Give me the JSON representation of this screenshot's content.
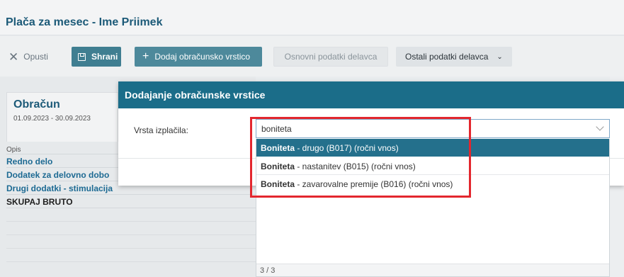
{
  "page": {
    "title": "Plača za mesec - Ime Priimek"
  },
  "toolbar": {
    "opusti": "Opusti",
    "shrani": "Shrani",
    "dodaj": "Dodaj obračunsko vrstico",
    "osnovni": "Osnovni podatki delavca",
    "ostali": "Ostali podatki delavca"
  },
  "obracun": {
    "title": "Obračun",
    "dates": "01.09.2023 - 30.09.2023",
    "column_header": "Opis",
    "rows": [
      "Redno delo",
      "Dodatek za delovno dobo",
      "Drugi dodatki - stimulacija",
      "SKUPAJ BRUTO"
    ]
  },
  "modal": {
    "title": "Dodajanje obračunske vrstice",
    "field_label": "Vrsta izplačila:",
    "select_value": "boniteta"
  },
  "dropdown": {
    "options": [
      {
        "bold": "Boniteta",
        "rest": " - drugo (B017) (ročni vnos)"
      },
      {
        "bold": "Boniteta",
        "rest": " - nastanitev (B015) (ročni vnos)"
      },
      {
        "bold": "Boniteta",
        "rest": " - zavarovalne premije (B016) (ročni vnos)"
      }
    ],
    "count": "3 / 3"
  },
  "colors": {
    "accent": "#1b6d89",
    "highlight": "#e3272e",
    "link": "#1d6a93"
  }
}
